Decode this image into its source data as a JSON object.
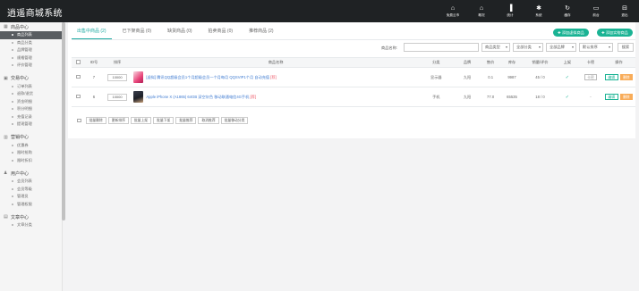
{
  "header": {
    "title": "逍遥商城系统",
    "nav": [
      {
        "label": "免费云市",
        "glyph": "⌂",
        "icon": "home-icon"
      },
      {
        "label": "概况",
        "glyph": "⌂",
        "icon": "overview-icon"
      },
      {
        "label": "统计",
        "glyph": "▐",
        "icon": "stats-icon"
      },
      {
        "label": "系统",
        "glyph": "✱",
        "icon": "system-icon"
      },
      {
        "label": "缓存",
        "glyph": "↻",
        "icon": "cache-icon"
      },
      {
        "label": "前台",
        "glyph": "▭",
        "icon": "frontend-icon"
      },
      {
        "label": "退出",
        "glyph": "⊟",
        "icon": "logout-icon"
      }
    ]
  },
  "sidebar": {
    "groups": [
      {
        "title": "商品中心",
        "icon": "goods-icon",
        "glyph": "▦",
        "items": [
          "商品列表",
          "商品分类",
          "品牌管理",
          "规格管理",
          "评价管理"
        ]
      },
      {
        "title": "交易中心",
        "icon": "trade-icon",
        "glyph": "▣",
        "items": [
          "订单列表",
          "退款/退货",
          "资金明细",
          "积分明细",
          "充值记录",
          "提现管理"
        ]
      },
      {
        "title": "营销中心",
        "icon": "marketing-icon",
        "glyph": "▥",
        "items": [
          "优惠券",
          "限时抢购",
          "限时折扣"
        ]
      },
      {
        "title": "用户中心",
        "icon": "user-icon",
        "glyph": "♟",
        "items": [
          "会员列表",
          "会员等级",
          "管理员",
          "管理权限"
        ]
      },
      {
        "title": "文章中心",
        "icon": "article-icon",
        "glyph": "▤",
        "items": [
          "文章分类"
        ]
      }
    ],
    "active_item": "商品列表"
  },
  "tabs": [
    {
      "label": "出售中商品 (2)",
      "active": true
    },
    {
      "label": "已下架商品 (0)",
      "active": false
    },
    {
      "label": "缺货商品 (0)",
      "active": false
    },
    {
      "label": "拍卖商品 (0)",
      "active": false
    },
    {
      "label": "推荐商品 (2)",
      "active": false
    }
  ],
  "actions": {
    "add_general": "添加虚拟商品",
    "add_physical": "添加实物商品"
  },
  "search": {
    "label": "商品名称:",
    "placeholder": "",
    "type_value": "商品类型",
    "category_value": "全部分类",
    "brand_value": "全部品牌",
    "sort_value": "默认排序",
    "button": "搜索"
  },
  "table": {
    "columns": [
      "",
      "ID号",
      "排序",
      "商品名称",
      "分类",
      "品牌",
      "售价",
      "库存",
      "销量/评价",
      "上架",
      "卡密",
      "操作"
    ],
    "rows": [
      {
        "id": "7",
        "sort": "10000",
        "name": "[虚拟] 腾讯QQ超级会员1个月超级会员一个月每月 QQSVIP1个月 自动充值",
        "tag": "[荐]",
        "category": "显示器",
        "brand": "九阳",
        "price": "0.1",
        "stock": "9987",
        "sales": "45 / 0",
        "on_sale": "✓",
        "card": "卡密",
        "op_edit": "编辑",
        "op_delete": "删除",
        "thumb_color": "#e8457a"
      },
      {
        "id": "6",
        "sort": "10000",
        "name": "Apple iPhone X (A1865) 64GB 深空灰色 移动联通电信4G手机",
        "tag": "[荐]",
        "category": "手机",
        "brand": "九阳",
        "price": "77.0",
        "stock": "65535",
        "sales": "18 / 0",
        "on_sale": "✓",
        "card": "-",
        "op_edit": "编辑",
        "op_delete": "删除",
        "thumb_color": "#2b2f3a"
      }
    ]
  },
  "bulk_actions": [
    "批量删除",
    "更新排序",
    "批量上架",
    "批量下架",
    "批量推荐",
    "取消推荐",
    "批量移动分类"
  ]
}
